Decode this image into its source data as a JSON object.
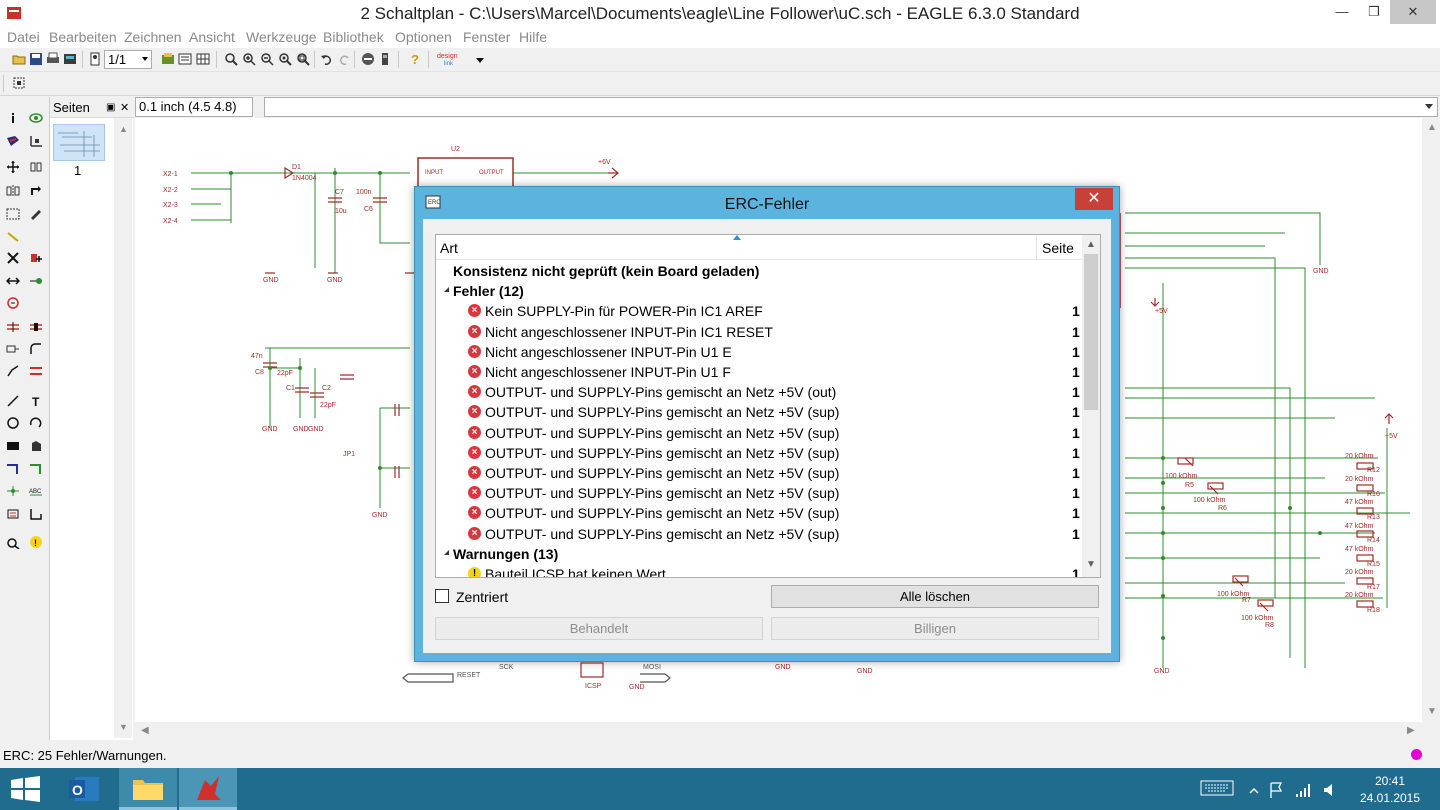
{
  "window": {
    "title": "2 Schaltplan - C:\\Users\\Marcel\\Documents\\eagle\\Line Follower\\uC.sch - EAGLE 6.3.0 Standard",
    "minimize": "—",
    "maximize": "❐",
    "close": "✕"
  },
  "menu": [
    "Datei",
    "Bearbeiten",
    "Zeichnen",
    "Ansicht",
    "Werkzeuge",
    "Bibliothek",
    "Optionen",
    "Fenster",
    "Hilfe"
  ],
  "toolbar": {
    "sheet_select": "1/1",
    "icons": [
      "open-icon",
      "save-icon",
      "print-icon",
      "cam-icon",
      "sheet-icon",
      "select-sheet",
      "script-icon",
      "zoom-fit-icon",
      "zoom-in-icon",
      "zoom-out-icon",
      "zoom-redraw-icon",
      "zoom-select-icon",
      "undo-icon",
      "redo-icon",
      "stop-icon",
      "go-icon",
      "help-icon",
      "design-link-icon"
    ]
  },
  "pages_panel": {
    "header": "Seiten",
    "pin": "▣",
    "close": "✕",
    "page_number": "1"
  },
  "coord": {
    "text": "0.1 inch (4.5 4.8)",
    "command": ""
  },
  "status": {
    "text": "ERC: 25 Fehler/Warnungen.",
    "indicator_color": "#e000d6"
  },
  "dialog": {
    "title": "ERC-Fehler",
    "close": "✕",
    "col_type": "Art",
    "col_page": "Seite",
    "rows": [
      {
        "kind": "header",
        "label": "Konsistenz nicht geprüft (kein Board geladen)",
        "page": ""
      },
      {
        "kind": "group",
        "label": "Fehler (12)",
        "page": ""
      },
      {
        "kind": "error",
        "label": "Kein SUPPLY-Pin für POWER-Pin IC1 AREF",
        "page": "1"
      },
      {
        "kind": "error",
        "label": "Nicht angeschlossener INPUT-Pin IC1 RESET",
        "page": "1"
      },
      {
        "kind": "error",
        "label": "Nicht angeschlossener INPUT-Pin U1 E",
        "page": "1"
      },
      {
        "kind": "error",
        "label": "Nicht angeschlossener INPUT-Pin U1 F",
        "page": "1"
      },
      {
        "kind": "error",
        "label": "OUTPUT- und SUPPLY-Pins gemischt an Netz +5V (out)",
        "page": "1"
      },
      {
        "kind": "error",
        "label": "OUTPUT- und SUPPLY-Pins gemischt an Netz +5V (sup)",
        "page": "1"
      },
      {
        "kind": "error",
        "label": "OUTPUT- und SUPPLY-Pins gemischt an Netz +5V (sup)",
        "page": "1"
      },
      {
        "kind": "error",
        "label": "OUTPUT- und SUPPLY-Pins gemischt an Netz +5V (sup)",
        "page": "1"
      },
      {
        "kind": "error",
        "label": "OUTPUT- und SUPPLY-Pins gemischt an Netz +5V (sup)",
        "page": "1"
      },
      {
        "kind": "error",
        "label": "OUTPUT- und SUPPLY-Pins gemischt an Netz +5V (sup)",
        "page": "1"
      },
      {
        "kind": "error",
        "label": "OUTPUT- und SUPPLY-Pins gemischt an Netz +5V (sup)",
        "page": "1"
      },
      {
        "kind": "error",
        "label": "OUTPUT- und SUPPLY-Pins gemischt an Netz +5V (sup)",
        "page": "1"
      },
      {
        "kind": "group",
        "label": "Warnungen (13)",
        "page": ""
      },
      {
        "kind": "warning",
        "label": "Bauteil ICSP hat keinen Wert",
        "page": "1"
      }
    ],
    "centered_label": "Zentriert",
    "clear_all": "Alle löschen",
    "handled": "Behandelt",
    "approve": "Billigen"
  },
  "schematic": {
    "labels": [
      "X2-1",
      "X2-2",
      "X2-3",
      "X2-4",
      "D1",
      "1N4004",
      "U2",
      "INPUT",
      "OUTPUT",
      "+6V",
      "C7",
      "10u",
      "100n",
      "C6",
      "GND",
      "GND",
      "47n",
      "C8",
      "22pF",
      "C1",
      "C2",
      "22pF",
      "GND",
      "GND",
      "GND",
      "JP1",
      "GND",
      "+5V",
      "20 kOhm",
      "R12",
      "20 kOhm",
      "R16",
      "47 kOhm",
      "R13",
      "47 kOhm",
      "R14",
      "47 kOhm",
      "R15",
      "20 kOhm",
      "R17",
      "20 kOhm",
      "R18",
      "100 kOhm",
      "R5",
      "100 kOhm",
      "R6",
      "100 kOhm",
      "R7",
      "100 kOhm",
      "R8",
      "GND",
      "RESET",
      "SCK",
      "MOSI",
      "ICSP",
      "GND",
      "GND",
      "GND",
      "+5V",
      "GND"
    ]
  },
  "taskbar": {
    "clock_time": "20:41",
    "clock_date": "24.01.2015",
    "apps": [
      "start-icon",
      "outlook-icon",
      "explorer-icon",
      "eagle-icon"
    ]
  },
  "colors": {
    "accent": "#5cb4de",
    "schematic_wire": "#2e8b2e",
    "schematic_part": "#a52a2a",
    "taskbar": "#1f6c8e"
  }
}
